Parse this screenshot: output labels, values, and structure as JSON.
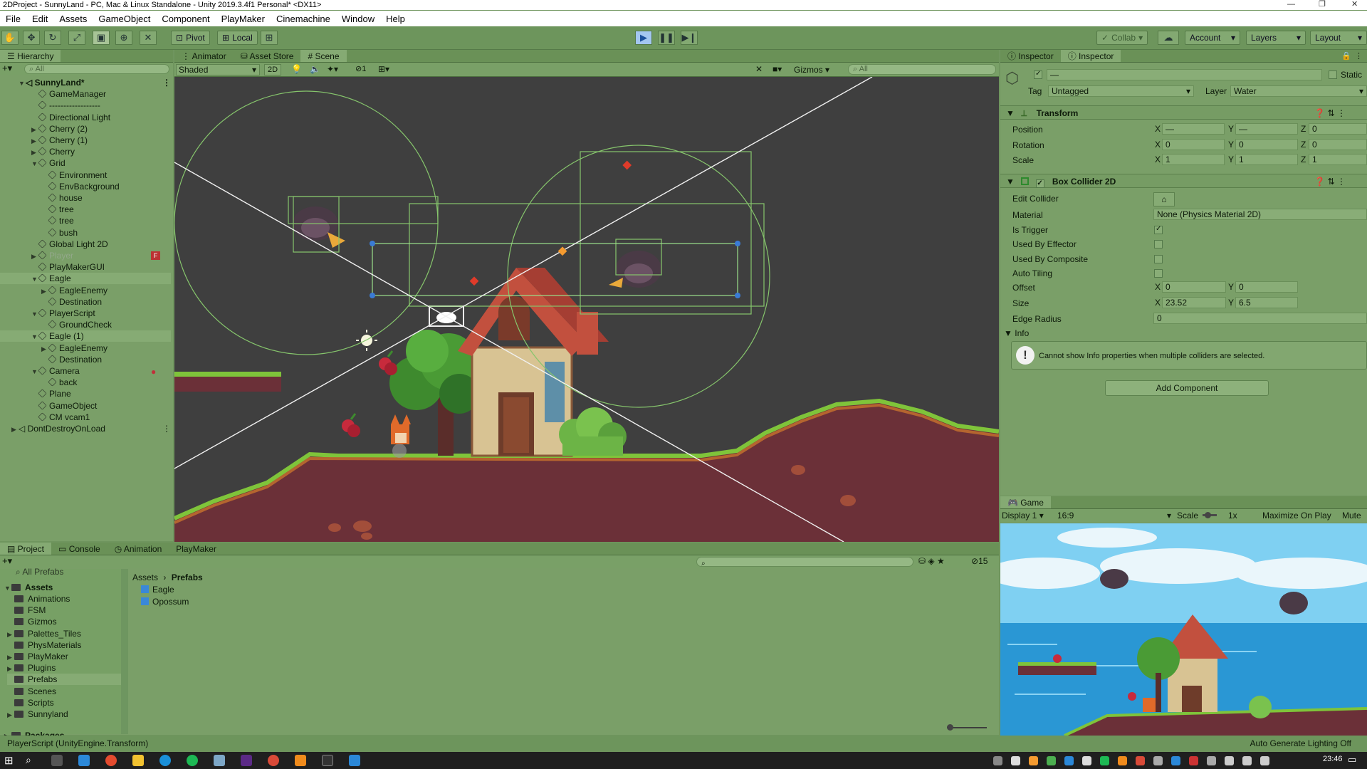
{
  "window": {
    "title": "2DProject - SunnyLand - PC, Mac & Linux Standalone - Unity 2019.3.4f1 Personal* <DX11>"
  },
  "menu": [
    "File",
    "Edit",
    "Assets",
    "GameObject",
    "Component",
    "PlayMaker",
    "Cinemachine",
    "Window",
    "Help"
  ],
  "toolbar": {
    "pivot": "Pivot",
    "local": "Local",
    "collab": "Collab",
    "account": "Account",
    "layers": "Layers",
    "layout": "Layout"
  },
  "hierarchy": {
    "title": "Hierarchy",
    "search": "All",
    "scene": "SunnyLand*",
    "items": [
      {
        "label": "GameManager"
      },
      {
        "label": "------------------"
      },
      {
        "label": "Directional Light"
      },
      {
        "label": "Cherry (2)"
      },
      {
        "label": "Cherry (1)"
      },
      {
        "label": "Cherry"
      },
      {
        "label": "Grid"
      },
      {
        "label": "Environment"
      },
      {
        "label": "EnvBackground"
      },
      {
        "label": "house"
      },
      {
        "label": "tree"
      },
      {
        "label": "tree"
      },
      {
        "label": "bush"
      },
      {
        "label": "Global Light 2D"
      },
      {
        "label": "Player"
      },
      {
        "label": "PlayMakerGUI"
      },
      {
        "label": "Eagle"
      },
      {
        "label": "EagleEnemy"
      },
      {
        "label": "Destination"
      },
      {
        "label": "PlayerScript"
      },
      {
        "label": "GroundCheck"
      },
      {
        "label": "Eagle (1)"
      },
      {
        "label": "EagleEnemy"
      },
      {
        "label": "Destination"
      },
      {
        "label": "Camera"
      },
      {
        "label": "back"
      },
      {
        "label": "Plane"
      },
      {
        "label": "GameObject"
      },
      {
        "label": "CM vcam1"
      },
      {
        "label": "DontDestroyOnLoad"
      }
    ]
  },
  "scene_tabs": {
    "animator": "Animator",
    "asset_store": "Asset Store",
    "scene": "Scene"
  },
  "scene_toolbar": {
    "shading": "Shaded",
    "mode2d": "2D",
    "layers_count": "1",
    "gizmos": "Gizmos",
    "search": "All"
  },
  "inspector": {
    "tab1": "Inspector",
    "tab2": "Inspector",
    "name": "—",
    "static": "Static",
    "tag_label": "Tag",
    "tag": "Untagged",
    "layer_label": "Layer",
    "layer": "Water",
    "transform": {
      "title": "Transform",
      "position": "Position",
      "rotation": "Rotation",
      "scale": "Scale",
      "pos": {
        "x": "—",
        "y": "—",
        "z": "0"
      },
      "rot": {
        "x": "0",
        "y": "0",
        "z": "0"
      },
      "scl": {
        "x": "1",
        "y": "1",
        "z": "1"
      }
    },
    "collider": {
      "title": "Box Collider 2D",
      "edit": "Edit Collider",
      "material_label": "Material",
      "material": "None (Physics Material 2D)",
      "is_trigger": "Is Trigger",
      "used_effector": "Used By Effector",
      "used_composite": "Used By Composite",
      "auto_tiling": "Auto Tiling",
      "offset": "Offset",
      "offset_x": "0",
      "offset_y": "0",
      "size": "Size",
      "size_x": "23.52",
      "size_y": "6.5",
      "edge_radius": "Edge Radius",
      "edge_val": "0",
      "info": "Info",
      "info_msg": "Cannot show Info properties when multiple colliders are selected."
    },
    "add_component": "Add Component"
  },
  "game": {
    "tab": "Game",
    "display": "Display 1",
    "aspect": "16:9",
    "scale_label": "Scale",
    "scale_val": "1x",
    "maximize": "Maximize On Play",
    "mute": "Mute"
  },
  "project": {
    "tabs": [
      "Project",
      "Console",
      "Animation",
      "PlayMaker"
    ],
    "favorites": "All Prefabs",
    "assets": "Assets",
    "folders": [
      "Animations",
      "FSM",
      "Gizmos",
      "Palettes_Tiles",
      "PhysMaterials",
      "PlayMaker",
      "Plugins",
      "Prefabs",
      "Scenes",
      "Scripts",
      "Sunnyland"
    ],
    "packages": "Packages",
    "breadcrumb_root": "Assets",
    "breadcrumb_leaf": "Prefabs",
    "files": [
      "Eagle",
      "Opossum"
    ],
    "hidden_count": "15"
  },
  "status": {
    "left": "PlayerScript (UnityEngine.Transform)",
    "right": "Auto Generate Lighting Off"
  },
  "taskbar": {
    "time": "23:46"
  },
  "colors": {
    "panel": "#7a9f68",
    "scene_bg": "#3f3f3f",
    "gizmo": "#86c56c",
    "accent": "#3a7bd5"
  }
}
